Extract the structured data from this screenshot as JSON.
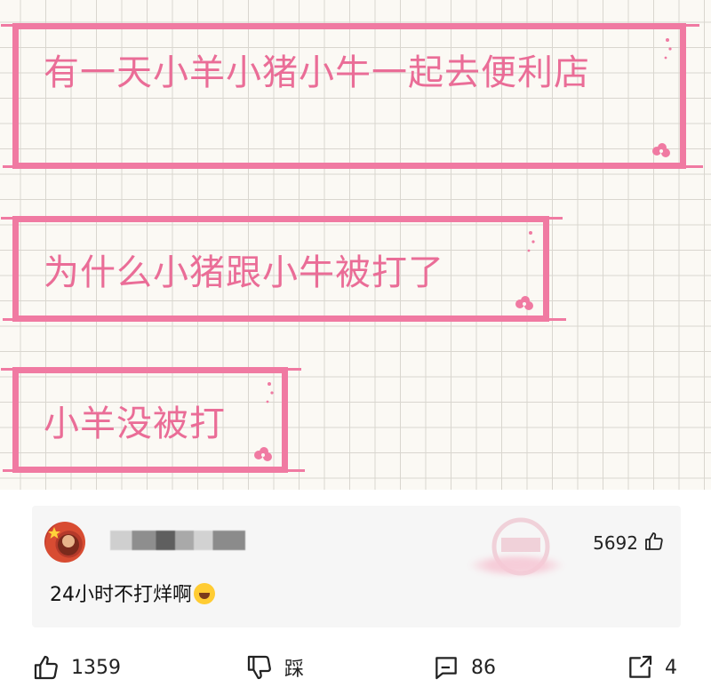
{
  "meme": {
    "line1": "有一天小羊小猪小牛一起去便利店",
    "line2": "为什么小猪跟小牛被打了",
    "line3": "小羊没被打",
    "colors": {
      "frame": "#f07aa2",
      "text": "#ea6d97",
      "grid": "#d9d6cf",
      "paper": "#fbf9f4"
    }
  },
  "comment": {
    "like_count": "5692",
    "text": "24小时不打烊啊",
    "emoji": "rolling-laughing-emoji"
  },
  "actions": {
    "like_count": "1359",
    "dislike_label": "踩",
    "comment_count": "86",
    "share_count": "4"
  }
}
